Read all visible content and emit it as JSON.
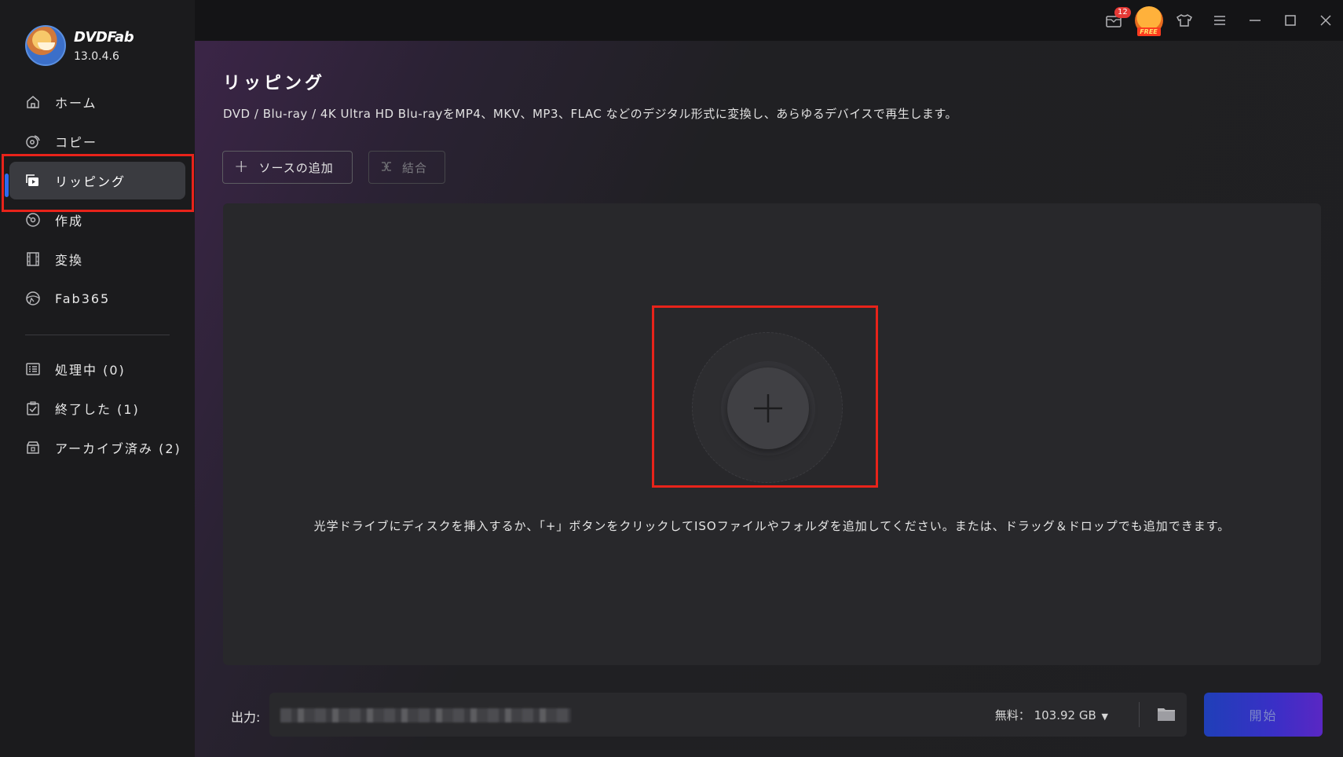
{
  "app": {
    "name": "DVDFab",
    "version": "13.0.4.6"
  },
  "sidebar": {
    "items": [
      {
        "label": "ホーム",
        "icon": "home-icon"
      },
      {
        "label": "コピー",
        "icon": "copy-disc-icon"
      },
      {
        "label": "リッピング",
        "icon": "ripping-icon",
        "active": true
      },
      {
        "label": "作成",
        "icon": "creator-disc-icon"
      },
      {
        "label": "変換",
        "icon": "film-icon"
      },
      {
        "label": "Fab365",
        "icon": "fab365-icon"
      }
    ],
    "tasks": [
      {
        "label": "処理中 (0)",
        "icon": "processing-list-icon"
      },
      {
        "label": "終了した (1)",
        "icon": "finished-clipboard-icon"
      },
      {
        "label": "アーカイブ済み (2)",
        "icon": "archive-box-icon"
      }
    ]
  },
  "titlebar": {
    "notification_count": "12",
    "free_badge_text": "FREE"
  },
  "main": {
    "title": "リッピング",
    "description": "DVD / Blu-ray / 4K Ultra HD Blu-rayをMP4、MKV、MP3、FLAC などのデジタル形式に変換し、あらゆるデバイスで再生します。",
    "add_source_label": "ソースの追加",
    "merge_label": "結合",
    "drop_hint": "光学ドライブにディスクを挿入するか、「+」ボタンをクリックしてISOファイルやフォルダを追加してください。または、ドラッグ＆ドロップでも追加できます。"
  },
  "output": {
    "label": "出力:",
    "free_space_label": "無料：",
    "free_space_value": "103.92 GB",
    "start_label": "開始"
  },
  "colors": {
    "accent": "#2f6af0",
    "highlight": "#e8231a",
    "start_gradient_from": "#1f3fb8",
    "start_gradient_to": "#5a27c4"
  }
}
